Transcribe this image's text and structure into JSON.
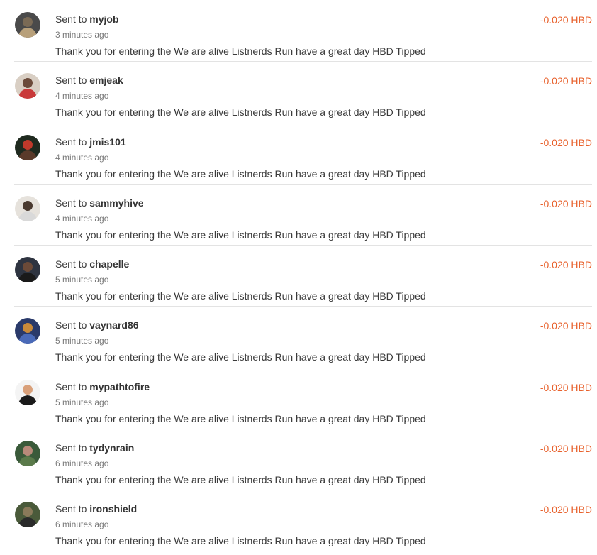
{
  "transfers": [
    {
      "prefix": "Sent to",
      "user": "myjob",
      "time": "3 minutes ago",
      "memo": "Thank you for entering the We are alive Listnerds Run have a great day HBD Tipped",
      "amount": "-0.020 HBD",
      "avatar_colors": [
        "#4a4a4a",
        "#7a6a55",
        "#b8a07a"
      ]
    },
    {
      "prefix": "Sent to",
      "user": "emjeak",
      "time": "4 minutes ago",
      "memo": "Thank you for entering the We are alive Listnerds Run have a great day HBD Tipped",
      "amount": "-0.020 HBD",
      "avatar_colors": [
        "#d9cfc4",
        "#6b4a3a",
        "#c93a3a"
      ]
    },
    {
      "prefix": "Sent to",
      "user": "jmis101",
      "time": "4 minutes ago",
      "memo": "Thank you for entering the We are alive Listnerds Run have a great day HBD Tipped",
      "amount": "-0.020 HBD",
      "avatar_colors": [
        "#1f2a1f",
        "#c0392b",
        "#5a3a2a"
      ]
    },
    {
      "prefix": "Sent to",
      "user": "sammyhive",
      "time": "4 minutes ago",
      "memo": "Thank you for entering the We are alive Listnerds Run have a great day HBD Tipped",
      "amount": "-0.020 HBD",
      "avatar_colors": [
        "#e6e2dc",
        "#4a3a30",
        "#d9d9d9"
      ]
    },
    {
      "prefix": "Sent to",
      "user": "chapelle",
      "time": "5 minutes ago",
      "memo": "Thank you for entering the We are alive Listnerds Run have a great day HBD Tipped",
      "amount": "-0.020 HBD",
      "avatar_colors": [
        "#2e3440",
        "#6b4a38",
        "#1a1a1a"
      ]
    },
    {
      "prefix": "Sent to",
      "user": "vaynard86",
      "time": "5 minutes ago",
      "memo": "Thank you for entering the We are alive Listnerds Run have a great day HBD Tipped",
      "amount": "-0.020 HBD",
      "avatar_colors": [
        "#2a3a6a",
        "#c98a3a",
        "#4a6ab8"
      ]
    },
    {
      "prefix": "Sent to",
      "user": "mypathtofire",
      "time": "5 minutes ago",
      "memo": "Thank you for entering the We are alive Listnerds Run have a great day HBD Tipped",
      "amount": "-0.020 HBD",
      "avatar_colors": [
        "#f4f4f4",
        "#d9a07a",
        "#1a1a1a"
      ]
    },
    {
      "prefix": "Sent to",
      "user": "tydynrain",
      "time": "6 minutes ago",
      "memo": "Thank you for entering the We are alive Listnerds Run have a great day HBD Tipped",
      "amount": "-0.020 HBD",
      "avatar_colors": [
        "#3a5a3a",
        "#b88a7a",
        "#5a7a4a"
      ]
    },
    {
      "prefix": "Sent to",
      "user": "ironshield",
      "time": "6 minutes ago",
      "memo": "Thank you for entering the We are alive Listnerds Run have a great day HBD Tipped",
      "amount": "-0.020 HBD",
      "avatar_colors": [
        "#4a5a3a",
        "#8a7a5a",
        "#2a2a2a"
      ]
    }
  ],
  "colors": {
    "amount": "#e8612c",
    "divider": "#e3e3e3",
    "text": "#3a3a3a",
    "muted": "#7a7a7a"
  }
}
